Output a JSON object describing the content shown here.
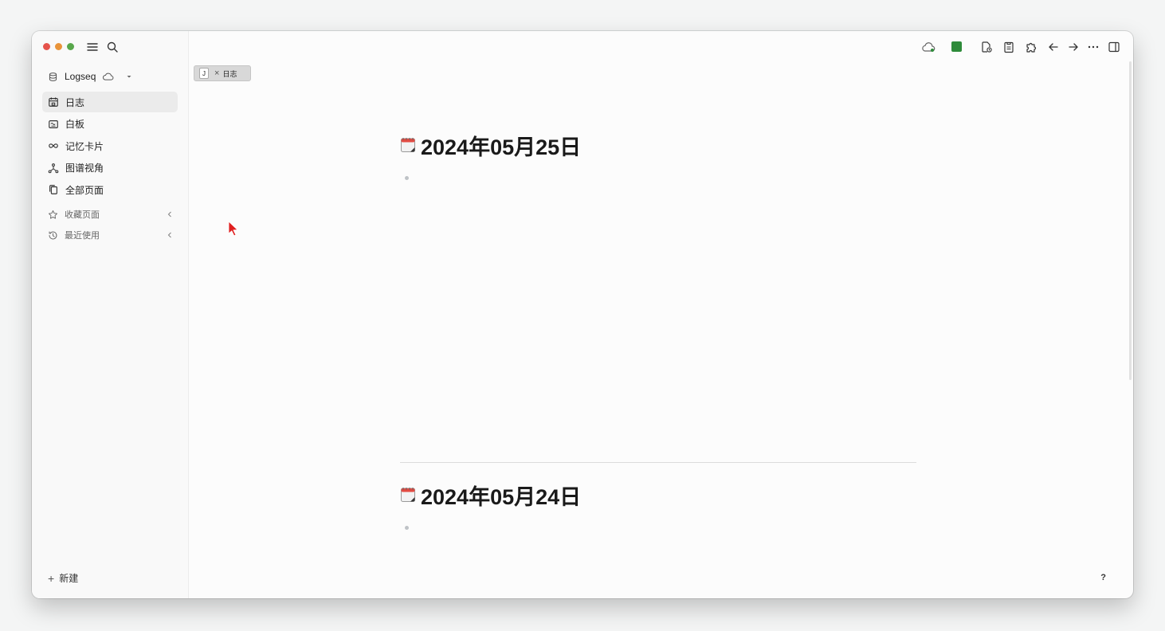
{
  "graph": {
    "name": "Logseq"
  },
  "nav": {
    "items": [
      {
        "label": "日志",
        "icon": "calendar-icon",
        "active": true
      },
      {
        "label": "白板",
        "icon": "whiteboard-icon",
        "active": false
      },
      {
        "label": "记忆卡片",
        "icon": "infinity-icon",
        "active": false
      },
      {
        "label": "图谱视角",
        "icon": "graph-icon",
        "active": false
      },
      {
        "label": "全部页面",
        "icon": "pages-icon",
        "active": false
      }
    ],
    "favorites_label": "收藏页面",
    "recent_label": "最近使用"
  },
  "new_label": "新建",
  "tab": {
    "key": "J",
    "label": "日志"
  },
  "journals": [
    {
      "title": "2024年05月25日"
    },
    {
      "title": "2024年05月24日"
    }
  ],
  "help_label": "?",
  "colors": {
    "sync_green": "#2e8b3a",
    "close": "#e5534b",
    "minimize": "#e9943a",
    "zoom": "#58a74b",
    "cursor": "#e02020"
  }
}
